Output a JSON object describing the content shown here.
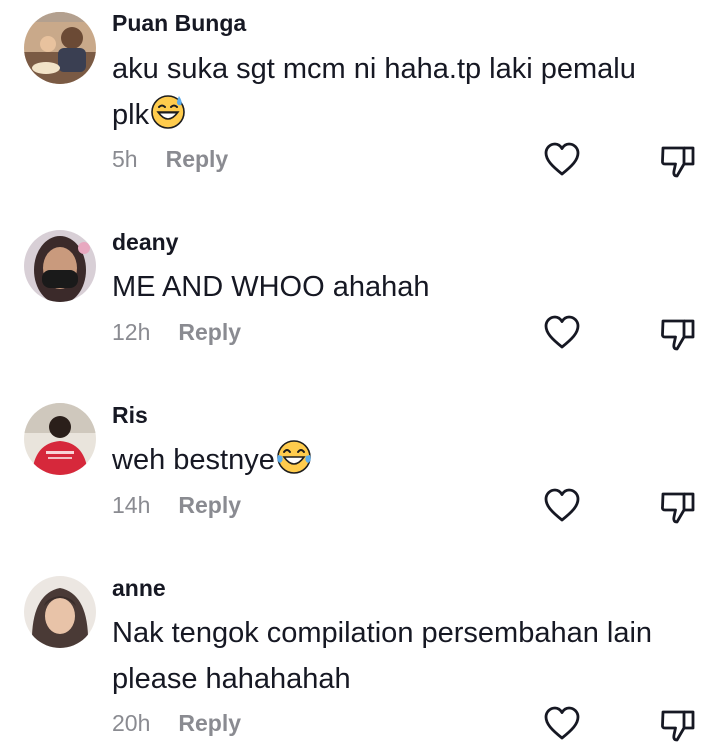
{
  "comments": [
    {
      "username": "Puan Bunga",
      "text": "aku suka sgt mcm ni haha.tp laki pemalu plk",
      "emoji": "sweat-smile-emoji",
      "time": "5h",
      "reply": "Reply"
    },
    {
      "username": "deany",
      "text": "ME AND WHOO ahahah",
      "time": "12h",
      "reply": "Reply"
    },
    {
      "username": "Ris",
      "text": "weh bestnye",
      "emoji": "tears-of-joy-emoji",
      "time": "14h",
      "reply": "Reply"
    },
    {
      "username": "anne",
      "text": "Nak tengok compilation persembahan lain please hahahahah",
      "time": "20h",
      "reply": "Reply"
    }
  ],
  "icons": {
    "like": "heart-outline-icon",
    "dislike": "thumbs-down-outline-icon"
  },
  "colors": {
    "primary_text": "#161823",
    "secondary_text": "#8a8b91",
    "background": "#ffffff"
  }
}
